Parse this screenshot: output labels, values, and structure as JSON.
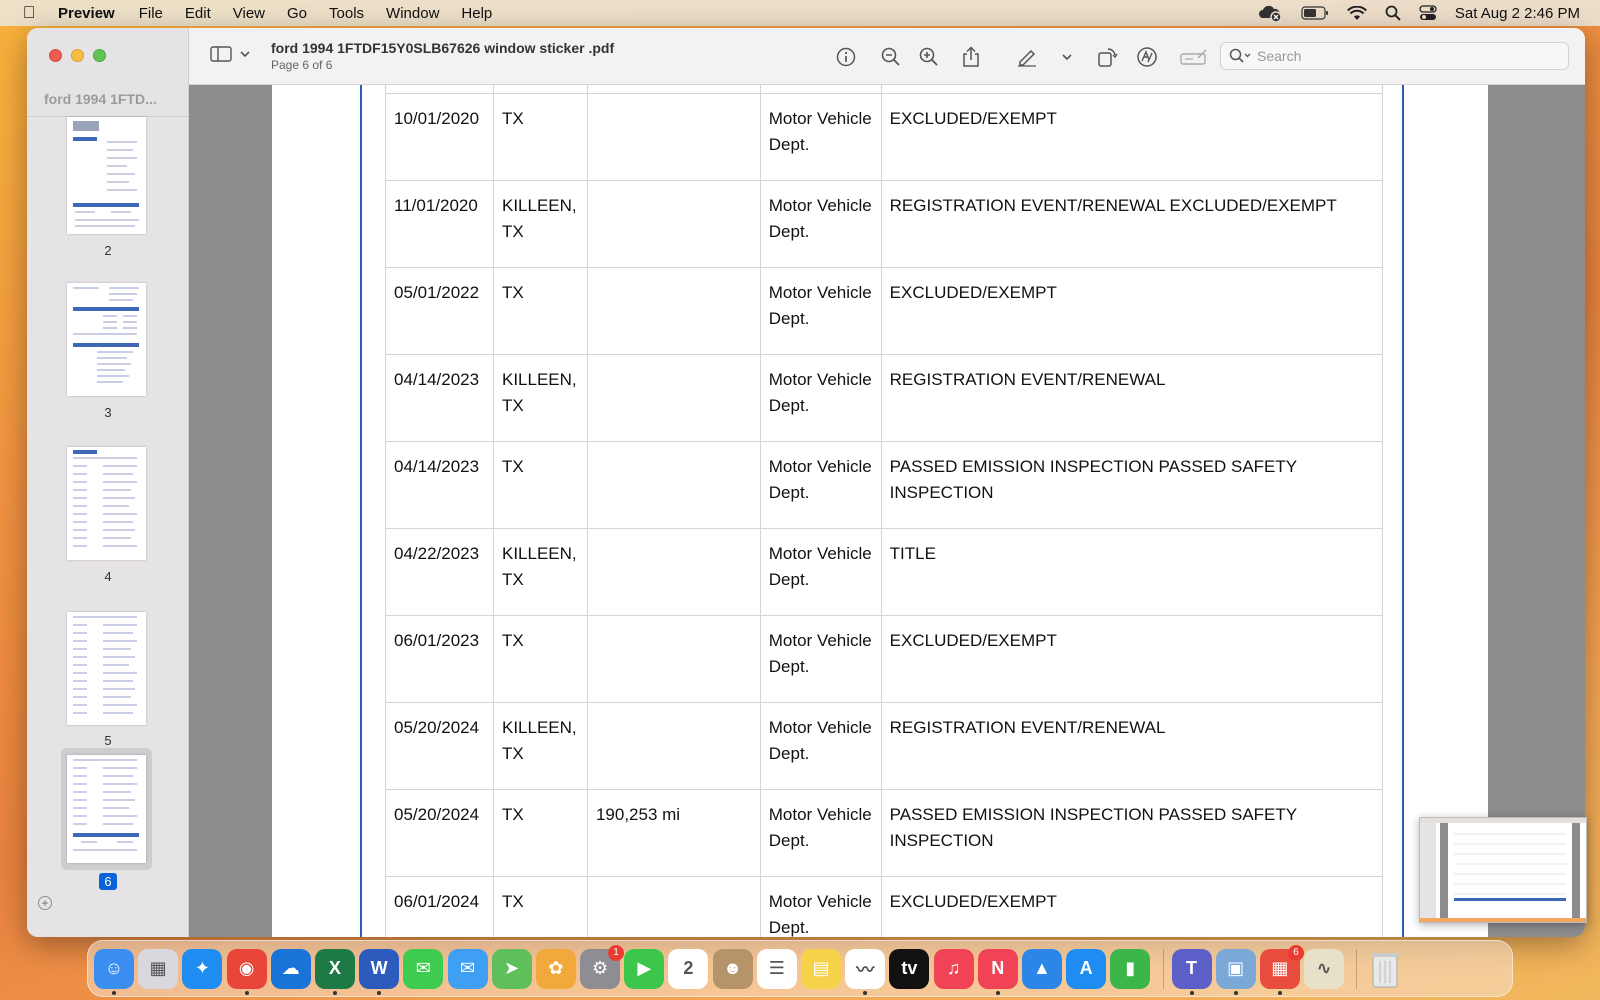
{
  "menubar": {
    "app_name": "Preview",
    "items": [
      "File",
      "Edit",
      "View",
      "Go",
      "Tools",
      "Window",
      "Help"
    ],
    "clock": "Sat Aug 2  2:46 PM"
  },
  "sidebar": {
    "doc_title_short": "ford 1994 1FTD...",
    "pages": [
      {
        "label": "2"
      },
      {
        "label": "3"
      },
      {
        "label": "4"
      },
      {
        "label": "5"
      },
      {
        "label": "6",
        "selected": true
      }
    ]
  },
  "toolbar": {
    "doc_title": "ford 1994 1FTDF15Y0SLB67626 window sticker .pdf",
    "page_indicator": "Page 6 of 6",
    "search_placeholder": "Search"
  },
  "history": {
    "rows": [
      {
        "date": "10/01/2020",
        "location": "TX",
        "odometer": "",
        "source": "Motor Vehicle Dept.",
        "details": "EXCLUDED/EXEMPT"
      },
      {
        "date": "11/01/2020",
        "location": "KILLEEN, TX",
        "odometer": "",
        "source": "Motor Vehicle Dept.",
        "details": "REGISTRATION EVENT/RENEWAL EXCLUDED/EXEMPT"
      },
      {
        "date": "05/01/2022",
        "location": "TX",
        "odometer": "",
        "source": "Motor Vehicle Dept.",
        "details": "EXCLUDED/EXEMPT"
      },
      {
        "date": "04/14/2023",
        "location": "KILLEEN, TX",
        "odometer": "",
        "source": "Motor Vehicle Dept.",
        "details": "REGISTRATION EVENT/RENEWAL"
      },
      {
        "date": "04/14/2023",
        "location": "TX",
        "odometer": "",
        "source": "Motor Vehicle Dept.",
        "details": "PASSED EMISSION INSPECTION PASSED SAFETY INSPECTION"
      },
      {
        "date": "04/22/2023",
        "location": "KILLEEN, TX",
        "odometer": "",
        "source": "Motor Vehicle Dept.",
        "details": "TITLE"
      },
      {
        "date": "06/01/2023",
        "location": "TX",
        "odometer": "",
        "source": "Motor Vehicle Dept.",
        "details": "EXCLUDED/EXEMPT"
      },
      {
        "date": "05/20/2024",
        "location": "KILLEEN, TX",
        "odometer": "",
        "source": "Motor Vehicle Dept.",
        "details": "REGISTRATION EVENT/RENEWAL"
      },
      {
        "date": "05/20/2024",
        "location": "TX",
        "odometer": "190,253 mi",
        "source": "Motor Vehicle Dept.",
        "details": "PASSED EMISSION INSPECTION PASSED SAFETY INSPECTION"
      },
      {
        "date": "06/01/2024",
        "location": "TX",
        "odometer": "",
        "source": "Motor Vehicle Dept.",
        "details": "EXCLUDED/EXEMPT"
      }
    ]
  },
  "dock": {
    "apps": [
      {
        "name": "Finder",
        "color": "#3a8ef0",
        "glyph": "☺",
        "running": true
      },
      {
        "name": "Launchpad",
        "color": "#d8d8de",
        "glyph": "▦",
        "running": false
      },
      {
        "name": "Safari",
        "color": "#1e8cf0",
        "glyph": "✦",
        "running": false
      },
      {
        "name": "Chrome",
        "color": "#e9463a",
        "glyph": "◉",
        "running": true
      },
      {
        "name": "OneDrive",
        "color": "#1a73d8",
        "glyph": "☁",
        "running": false
      },
      {
        "name": "Excel",
        "color": "#1d7a45",
        "glyph": "X",
        "running": true
      },
      {
        "name": "Word",
        "color": "#2a5bbd",
        "glyph": "W",
        "running": true
      },
      {
        "name": "Messages",
        "color": "#3fcb4f",
        "glyph": "✉",
        "running": false
      },
      {
        "name": "Mail",
        "color": "#3f9ff2",
        "glyph": "✉",
        "running": false
      },
      {
        "name": "Maps",
        "color": "#5fbf5a",
        "glyph": "➤",
        "running": false
      },
      {
        "name": "Photos",
        "color": "#f2a93b",
        "glyph": "✿",
        "running": false
      },
      {
        "name": "System Settings",
        "color": "#8d8d93",
        "glyph": "⚙",
        "running": false,
        "badge": "1"
      },
      {
        "name": "FaceTime",
        "color": "#3cc74c",
        "glyph": "▶",
        "running": false
      },
      {
        "name": "Calendar",
        "color": "#ffffff",
        "glyph": "2",
        "running": false
      },
      {
        "name": "Contacts",
        "color": "#b59469",
        "glyph": "☻",
        "running": false
      },
      {
        "name": "Reminders",
        "color": "#ffffff",
        "glyph": "☰",
        "running": false
      },
      {
        "name": "Notes",
        "color": "#f6d24a",
        "glyph": "▤",
        "running": false
      },
      {
        "name": "Freeform",
        "color": "#ffffff",
        "glyph": "〰",
        "running": true
      },
      {
        "name": "Apple TV",
        "color": "#111111",
        "glyph": "tv",
        "running": false
      },
      {
        "name": "Music",
        "color": "#f04356",
        "glyph": "♫",
        "running": false
      },
      {
        "name": "News",
        "color": "#f04356",
        "glyph": "N",
        "running": true
      },
      {
        "name": "Keynote",
        "color": "#2c86e8",
        "glyph": "▲",
        "running": false
      },
      {
        "name": "App Store",
        "color": "#1e8cf0",
        "glyph": "A",
        "running": false
      },
      {
        "name": "Numbers",
        "color": "#3cb54a",
        "glyph": "▮",
        "running": false
      },
      {
        "name": "Teams",
        "color": "#5b5fc7",
        "glyph": "T",
        "running": true
      },
      {
        "name": "Preview",
        "color": "#7aa9d8",
        "glyph": "▣",
        "running": true
      },
      {
        "name": "Microsoft 365",
        "color": "#e84c3d",
        "glyph": "▦",
        "running": true,
        "badge": "6"
      },
      {
        "name": "Grapher",
        "color": "#e7e1c8",
        "glyph": "∿",
        "running": false
      }
    ],
    "trash_label": "Trash"
  }
}
